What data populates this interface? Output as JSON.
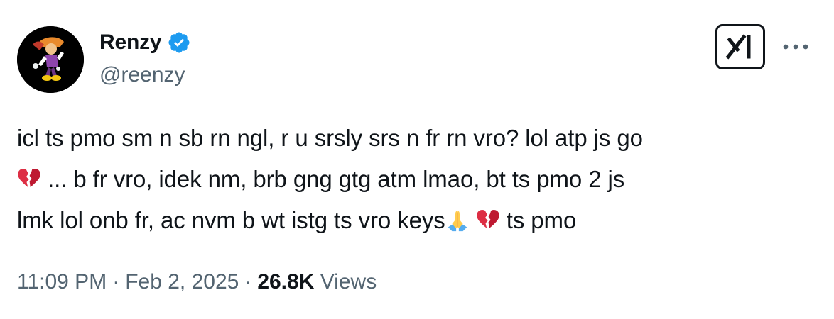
{
  "author": {
    "display_name": "Renzy",
    "handle": "@reenzy",
    "verified": true,
    "verified_color": "#1d9bf0"
  },
  "tweet": {
    "lines": [
      {
        "before": "icl ts pmo sm n sb rn ngl, r u srsly srs n fr rn vro? lol atp js go",
        "emojis_after": [],
        "after": ""
      },
      {
        "before": "",
        "emojis_after": [
          "broken-heart"
        ],
        "after": "... b fr vro, idek nm, brb gng gtg atm lmao, bt ts pmo 2 js"
      },
      {
        "before": "lmk lol onb fr, ac nvm b wt istg ts vro keys",
        "emojis_after": [
          "folded-hands",
          "broken-heart"
        ],
        "after": " ts pmo"
      }
    ]
  },
  "meta": {
    "time": "11:09 PM",
    "separator": "·",
    "date": "Feb 2, 2025",
    "views_count": "26.8K",
    "views_label": "Views"
  },
  "actions": {
    "grok_icon": "grok-icon",
    "more_icon": "more-icon"
  },
  "colors": {
    "text": "#0f1419",
    "secondary": "#536471",
    "verified": "#1d9bf0"
  }
}
